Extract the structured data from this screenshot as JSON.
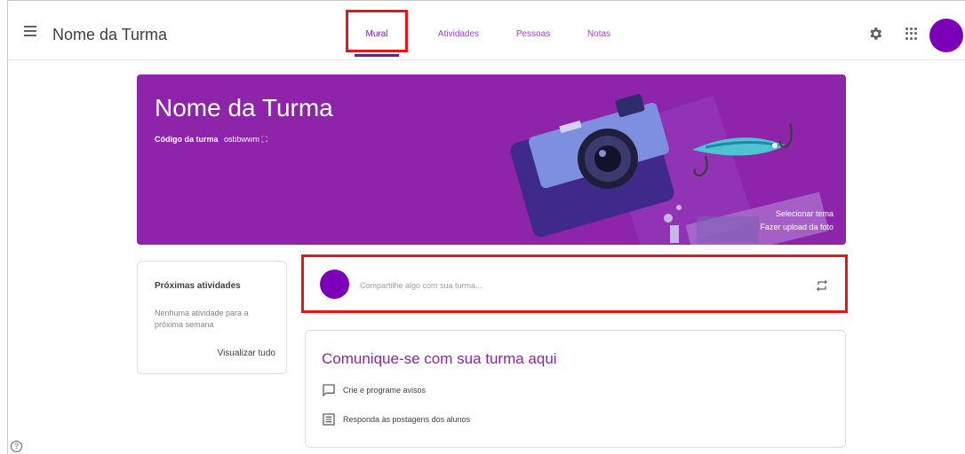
{
  "header": {
    "menu_icon": "hamburger-menu-icon",
    "title": "Nome da Turma",
    "tabs": [
      {
        "label": "Mural",
        "active": true
      },
      {
        "label": "Atividades",
        "active": false
      },
      {
        "label": "Pessoas",
        "active": false
      },
      {
        "label": "Notas",
        "active": false
      }
    ],
    "settings_icon": "gear-icon",
    "apps_icon": "apps-grid-icon"
  },
  "banner": {
    "title": "Nome da Turma",
    "code_label": "Código da turma",
    "code_value": "osbbwwm",
    "select_theme": "Selecionar tema",
    "upload_photo": "Fazer upload da foto"
  },
  "upcoming": {
    "title": "Próximas atividades",
    "empty_text": "Nenhuma atividade para a próxima semana",
    "view_all": "Visualizar tudo"
  },
  "share": {
    "placeholder": "Compartilhe algo com sua turma..."
  },
  "communicate": {
    "title": "Comunique-se com sua turma aqui",
    "items": [
      {
        "label": "Crie e programe avisos",
        "icon": "announcement-icon"
      },
      {
        "label": "Responda às postagens dos alunos",
        "icon": "list-post-icon"
      }
    ]
  },
  "colors": {
    "accent": "#8e24aa",
    "avatar": "#7b00b8",
    "highlight": "#e8141c"
  }
}
